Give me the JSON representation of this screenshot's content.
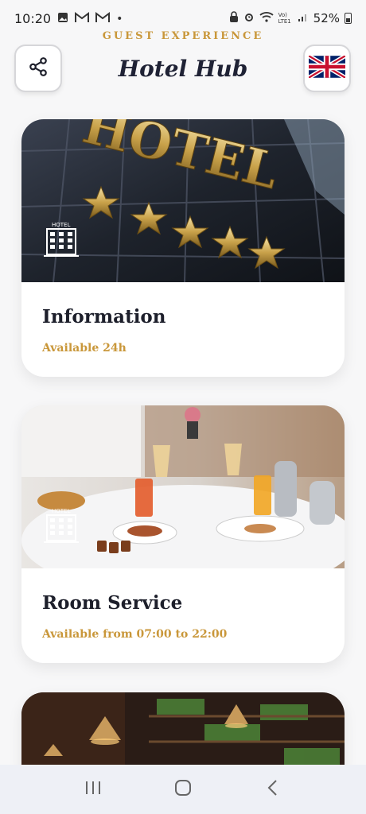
{
  "status": {
    "time": "10:20",
    "left_icons": [
      "image-icon",
      "gmail-icon",
      "gmail-icon",
      "dot-icon"
    ],
    "battery": "52%",
    "network": "Vo) LTE1"
  },
  "header": {
    "subtitle": "GUEST EXPERIENCE",
    "title": "Hotel Hub",
    "share_icon": "share-icon",
    "language_flag": "uk-flag-icon"
  },
  "cards": [
    {
      "title": "Information",
      "subtitle": "Available 24h",
      "image": "hotel-facade-photo",
      "icon_label": "HOTEL"
    },
    {
      "title": "Room Service",
      "subtitle": "Available from 07:00 to 22:00",
      "image": "breakfast-in-bed-photo",
      "icon_label": "HOTEL"
    },
    {
      "image": "bar-shelves-photo"
    }
  ],
  "nav": {
    "recents": "recents-icon",
    "home": "home-icon",
    "back": "back-icon"
  },
  "colors": {
    "accent": "#c9973a",
    "title": "#1f2235",
    "background": "#f7f7f8"
  }
}
